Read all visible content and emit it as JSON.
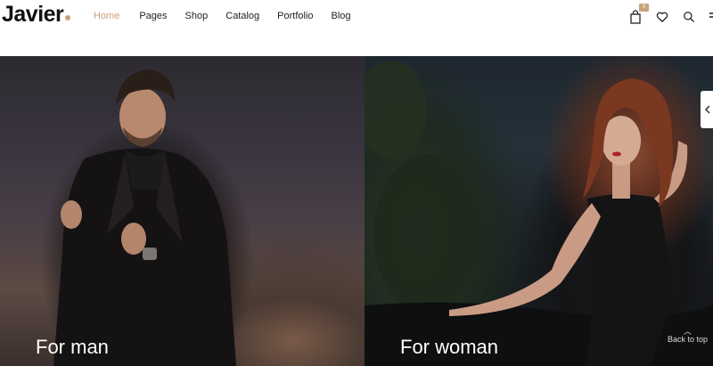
{
  "header": {
    "logo": "Javier",
    "nav": [
      "Home",
      "Pages",
      "Shop",
      "Catalog",
      "Portfolio",
      "Blog"
    ],
    "active_nav": "Home",
    "cart_count": "0",
    "icons": [
      "cart-icon",
      "heart-icon",
      "search-icon",
      "menu-icon"
    ]
  },
  "banners": [
    {
      "label": "For man"
    },
    {
      "label": "For woman"
    }
  ],
  "back_to_top": "Back to top",
  "colors": {
    "accent": "#c9a27a",
    "text": "#222222"
  }
}
